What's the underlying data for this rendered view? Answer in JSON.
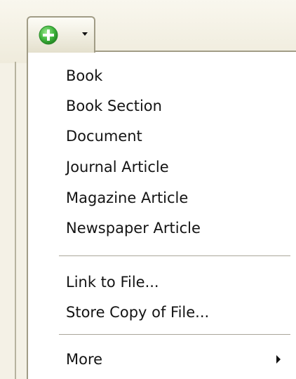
{
  "toolbar": {
    "add_button": {
      "icon": "plus-circle-icon",
      "dropdown_icon": "chevron-down-icon",
      "accent_color": "#3db33a"
    }
  },
  "menu": {
    "item_types": [
      {
        "label": "Book"
      },
      {
        "label": "Book Section"
      },
      {
        "label": "Document"
      },
      {
        "label": "Journal Article"
      },
      {
        "label": "Magazine Article"
      },
      {
        "label": "Newspaper Article"
      }
    ],
    "file_actions": [
      {
        "label": "Link to File..."
      },
      {
        "label": "Store Copy of File..."
      }
    ],
    "more": {
      "label": "More",
      "icon": "submenu-arrow-icon"
    }
  }
}
